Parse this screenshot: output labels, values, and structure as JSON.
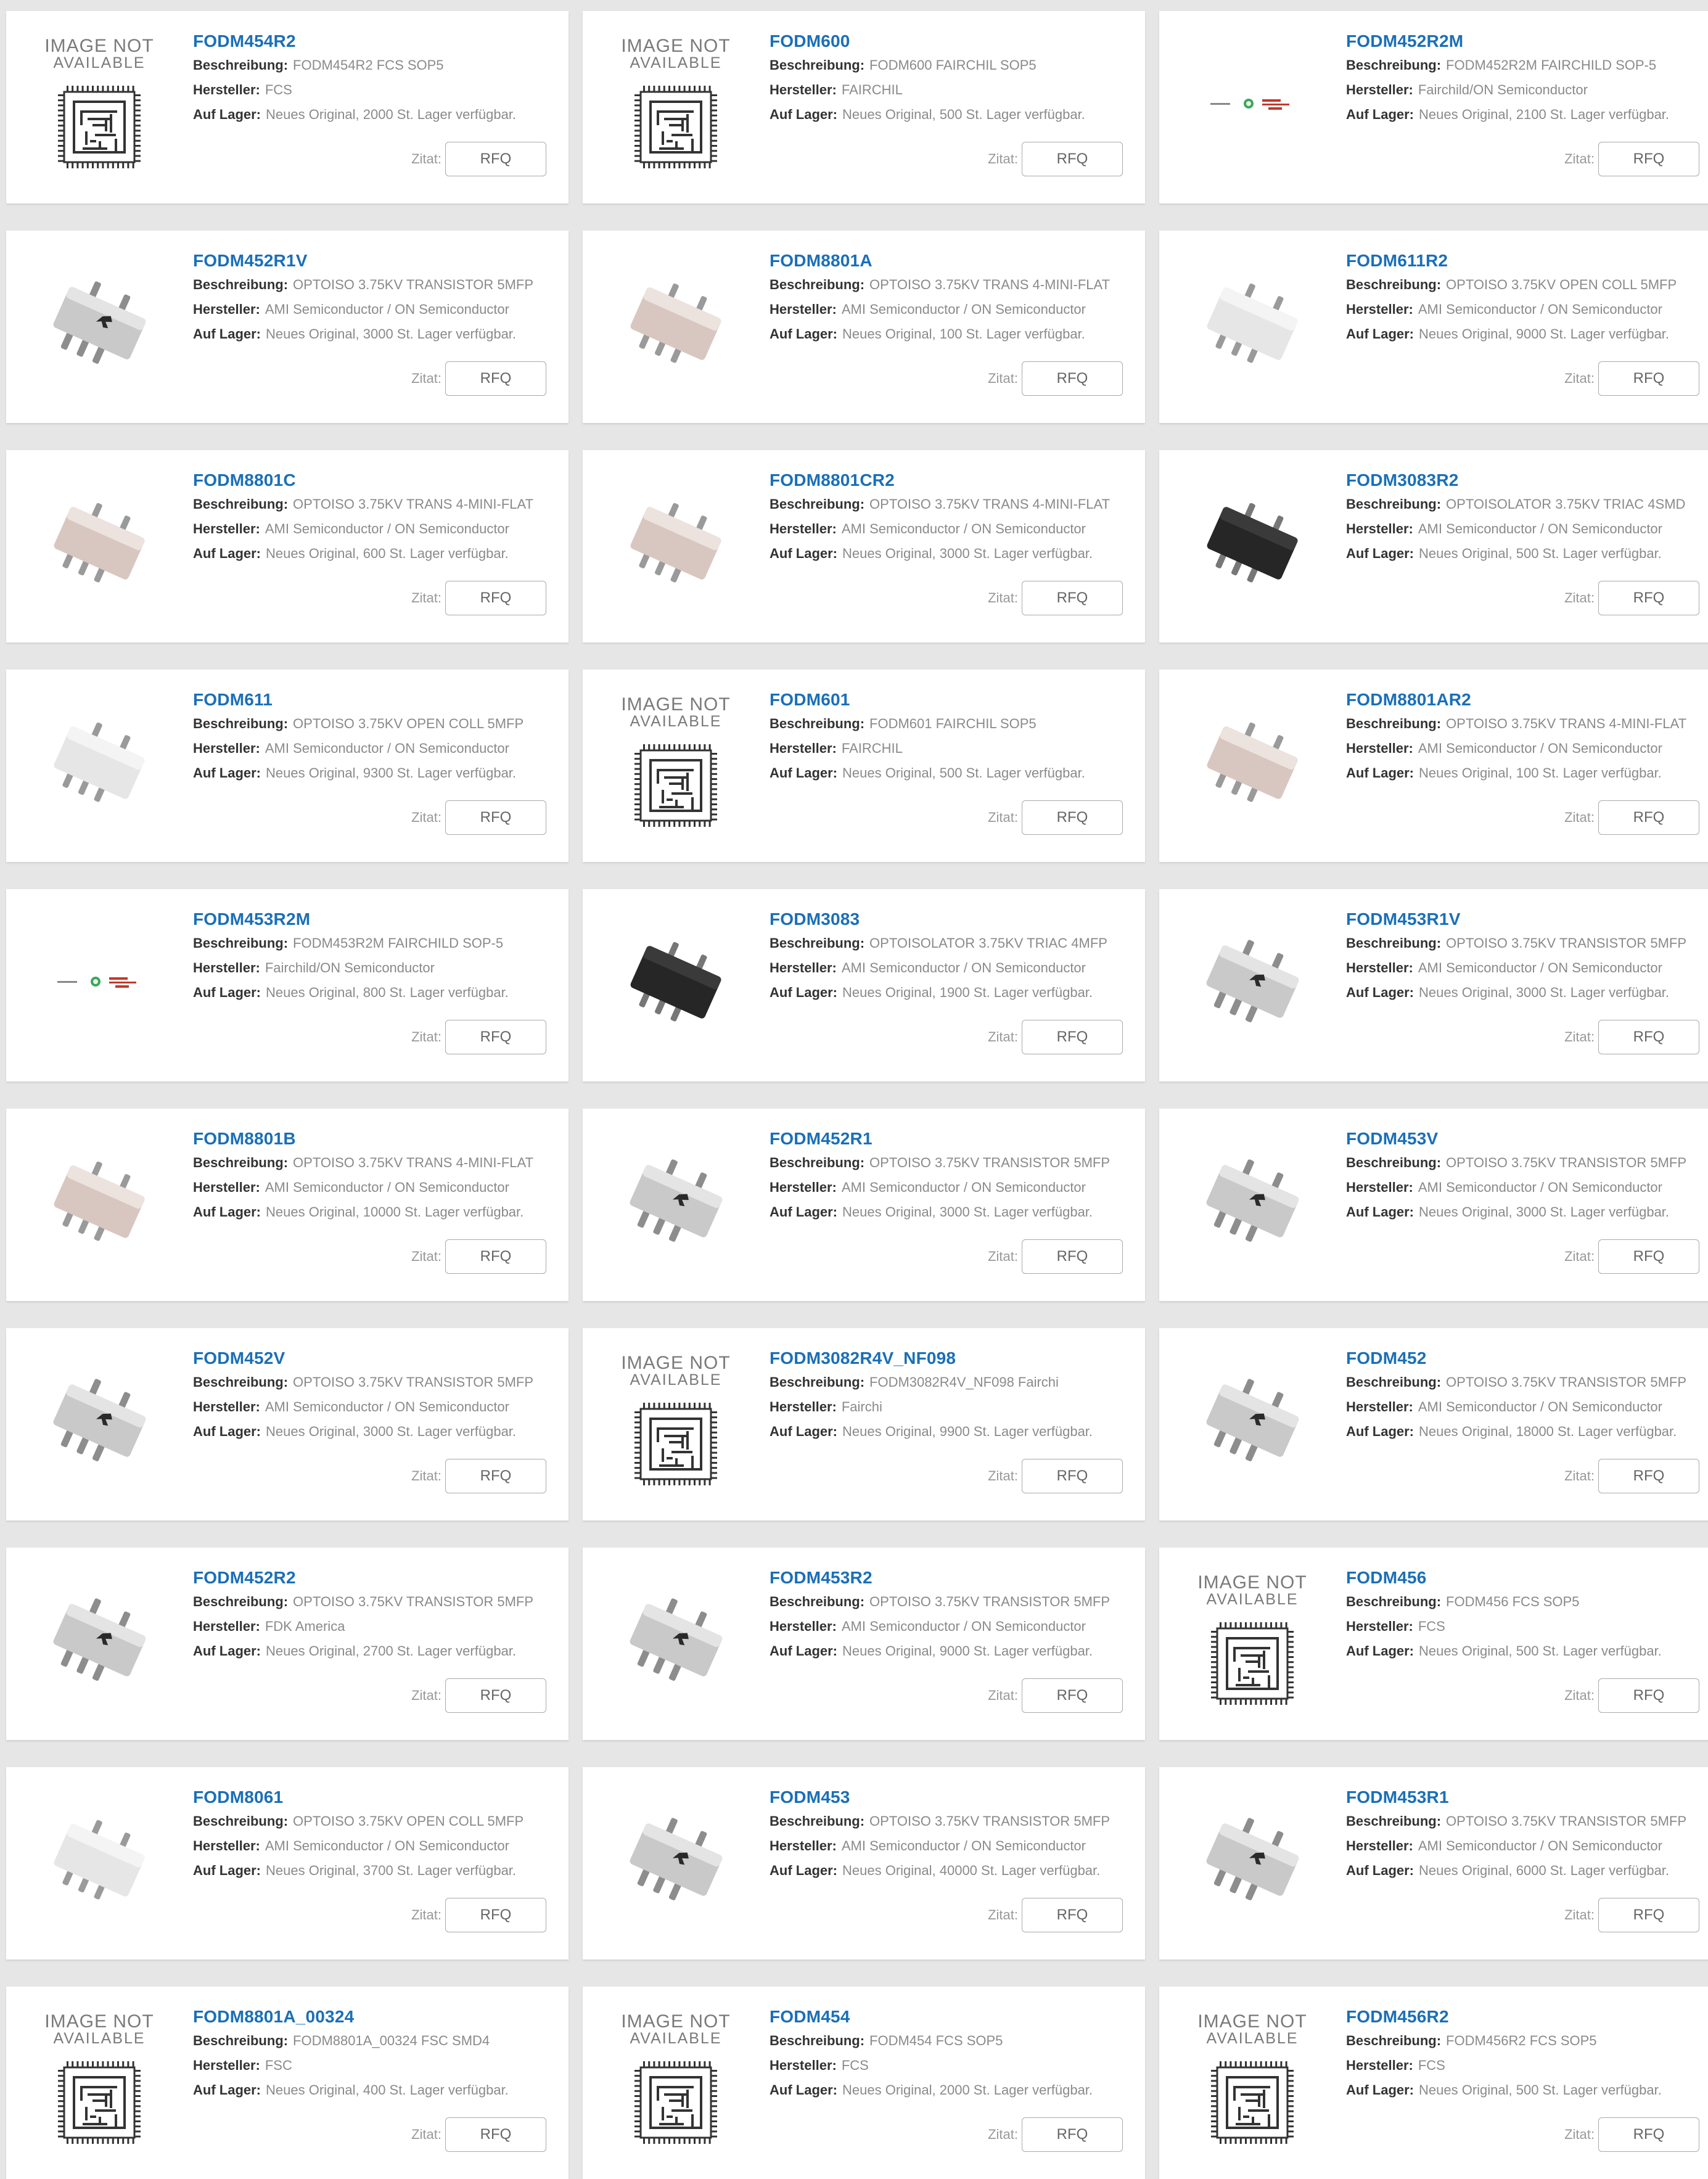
{
  "labels": {
    "beschreibung": "Beschreibung:",
    "hersteller": "Hersteller:",
    "auf_lager": "Auf Lager:",
    "zitat": "Zitat:",
    "rfq": "RFQ",
    "image_not_1": "IMAGE NOT",
    "image_not_2": "AVAILABLE"
  },
  "products": [
    {
      "pn": "FODM454R2",
      "desc": "FODM454R2 FCS SOP5",
      "mfr": "FCS",
      "stock": "Neues Original, 2000 St. Lager verfügbar.",
      "img": "na"
    },
    {
      "pn": "FODM600",
      "desc": "FODM600 FAIRCHIL SOP5",
      "mfr": "FAIRCHIL",
      "stock": "Neues Original, 500 St. Lager verfügbar.",
      "img": "na"
    },
    {
      "pn": "FODM452R2M",
      "desc": "FODM452R2M FAIRCHILD SOP-5",
      "mfr": "Fairchild/ON Semiconductor",
      "stock": "Neues Original, 2100 St. Lager verfügbar.",
      "img": "logo"
    },
    {
      "pn": "FODM452R1V",
      "desc": "OPTOISO 3.75KV TRANSISTOR 5MFP",
      "mfr": "AMI Semiconductor / ON Semiconductor",
      "stock": "Neues Original, 3000 St. Lager verfügbar.",
      "img": "gray"
    },
    {
      "pn": "FODM8801A",
      "desc": "OPTOISO 3.75KV TRANS 4-MINI-FLAT",
      "mfr": "AMI Semiconductor / ON Semiconductor",
      "stock": "Neues Original, 100 St. Lager verfügbar.",
      "img": "pink"
    },
    {
      "pn": "FODM611R2",
      "desc": "OPTOISO 3.75KV OPEN COLL 5MFP",
      "mfr": "AMI Semiconductor / ON Semiconductor",
      "stock": "Neues Original, 9000 St. Lager verfügbar.",
      "img": "white"
    },
    {
      "pn": "FODM8801C",
      "desc": "OPTOISO 3.75KV TRANS 4-MINI-FLAT",
      "mfr": "AMI Semiconductor / ON Semiconductor",
      "stock": "Neues Original, 600 St. Lager verfügbar.",
      "img": "pink"
    },
    {
      "pn": "FODM8801CR2",
      "desc": "OPTOISO 3.75KV TRANS 4-MINI-FLAT",
      "mfr": "AMI Semiconductor / ON Semiconductor",
      "stock": "Neues Original, 3000 St. Lager verfügbar.",
      "img": "pink"
    },
    {
      "pn": "FODM3083R2",
      "desc": "OPTOISOLATOR 3.75KV TRIAC 4SMD",
      "mfr": "AMI Semiconductor / ON Semiconductor",
      "stock": "Neues Original, 500 St. Lager verfügbar.",
      "img": "black"
    },
    {
      "pn": "FODM611",
      "desc": "OPTOISO 3.75KV OPEN COLL 5MFP",
      "mfr": "AMI Semiconductor / ON Semiconductor",
      "stock": "Neues Original, 9300 St. Lager verfügbar.",
      "img": "white"
    },
    {
      "pn": "FODM601",
      "desc": "FODM601 FAIRCHIL SOP5",
      "mfr": "FAIRCHIL",
      "stock": "Neues Original, 500 St. Lager verfügbar.",
      "img": "na"
    },
    {
      "pn": "FODM8801AR2",
      "desc": "OPTOISO 3.75KV TRANS 4-MINI-FLAT",
      "mfr": "AMI Semiconductor / ON Semiconductor",
      "stock": "Neues Original, 100 St. Lager verfügbar.",
      "img": "pink"
    },
    {
      "pn": "FODM453R2M",
      "desc": "FODM453R2M FAIRCHILD SOP-5",
      "mfr": "Fairchild/ON Semiconductor",
      "stock": "Neues Original, 800 St. Lager verfügbar.",
      "img": "logo"
    },
    {
      "pn": "FODM3083",
      "desc": "OPTOISOLATOR 3.75KV TRIAC 4MFP",
      "mfr": "AMI Semiconductor / ON Semiconductor",
      "stock": "Neues Original, 1900 St. Lager verfügbar.",
      "img": "black"
    },
    {
      "pn": "FODM453R1V",
      "desc": "OPTOISO 3.75KV TRANSISTOR 5MFP",
      "mfr": "AMI Semiconductor / ON Semiconductor",
      "stock": "Neues Original, 3000 St. Lager verfügbar.",
      "img": "gray"
    },
    {
      "pn": "FODM8801B",
      "desc": "OPTOISO 3.75KV TRANS 4-MINI-FLAT",
      "mfr": "AMI Semiconductor / ON Semiconductor",
      "stock": "Neues Original, 10000 St. Lager verfügbar.",
      "img": "pink"
    },
    {
      "pn": "FODM452R1",
      "desc": "OPTOISO 3.75KV TRANSISTOR 5MFP",
      "mfr": "AMI Semiconductor / ON Semiconductor",
      "stock": "Neues Original, 3000 St. Lager verfügbar.",
      "img": "gray"
    },
    {
      "pn": "FODM453V",
      "desc": "OPTOISO 3.75KV TRANSISTOR 5MFP",
      "mfr": "AMI Semiconductor / ON Semiconductor",
      "stock": "Neues Original, 3000 St. Lager verfügbar.",
      "img": "gray"
    },
    {
      "pn": "FODM452V",
      "desc": "OPTOISO 3.75KV TRANSISTOR 5MFP",
      "mfr": "AMI Semiconductor / ON Semiconductor",
      "stock": "Neues Original, 3000 St. Lager verfügbar.",
      "img": "gray"
    },
    {
      "pn": "FODM3082R4V_NF098",
      "desc": "FODM3082R4V_NF098 Fairchi",
      "mfr": "Fairchi",
      "stock": "Neues Original, 9900 St. Lager verfügbar.",
      "img": "na"
    },
    {
      "pn": "FODM452",
      "desc": "OPTOISO 3.75KV TRANSISTOR 5MFP",
      "mfr": "AMI Semiconductor / ON Semiconductor",
      "stock": "Neues Original, 18000 St. Lager verfügbar.",
      "img": "gray"
    },
    {
      "pn": "FODM452R2",
      "desc": "OPTOISO 3.75KV TRANSISTOR 5MFP",
      "mfr": "FDK America",
      "stock": "Neues Original, 2700 St. Lager verfügbar.",
      "img": "gray"
    },
    {
      "pn": "FODM453R2",
      "desc": "OPTOISO 3.75KV TRANSISTOR 5MFP",
      "mfr": "AMI Semiconductor / ON Semiconductor",
      "stock": "Neues Original, 9000 St. Lager verfügbar.",
      "img": "gray"
    },
    {
      "pn": "FODM456",
      "desc": "FODM456 FCS SOP5",
      "mfr": "FCS",
      "stock": "Neues Original, 500 St. Lager verfügbar.",
      "img": "na"
    },
    {
      "pn": "FODM8061",
      "desc": "OPTOISO 3.75KV OPEN COLL 5MFP",
      "mfr": "AMI Semiconductor / ON Semiconductor",
      "stock": "Neues Original, 3700 St. Lager verfügbar.",
      "img": "white"
    },
    {
      "pn": "FODM453",
      "desc": "OPTOISO 3.75KV TRANSISTOR 5MFP",
      "mfr": "AMI Semiconductor / ON Semiconductor",
      "stock": "Neues Original, 40000 St. Lager verfügbar.",
      "img": "gray"
    },
    {
      "pn": "FODM453R1",
      "desc": "OPTOISO 3.75KV TRANSISTOR 5MFP",
      "mfr": "AMI Semiconductor / ON Semiconductor",
      "stock": "Neues Original, 6000 St. Lager verfügbar.",
      "img": "gray"
    },
    {
      "pn": "FODM8801A_00324",
      "desc": "FODM8801A_00324  FSC SMD4",
      "mfr": "FSC",
      "stock": "Neues Original, 400 St. Lager verfügbar.",
      "img": "na"
    },
    {
      "pn": "FODM454",
      "desc": "FODM454 FCS SOP5",
      "mfr": "FCS",
      "stock": "Neues Original, 2000 St. Lager verfügbar.",
      "img": "na"
    },
    {
      "pn": "FODM456R2",
      "desc": "FODM456R2 FCS SOP5",
      "mfr": "FCS",
      "stock": "Neues Original, 500 St. Lager verfügbar.",
      "img": "na"
    }
  ],
  "colors": {
    "part_number": "#1a6fb8",
    "page_bg": "#e6e6e6",
    "card_bg": "#ffffff",
    "muted_text": "#8a8a8a"
  }
}
